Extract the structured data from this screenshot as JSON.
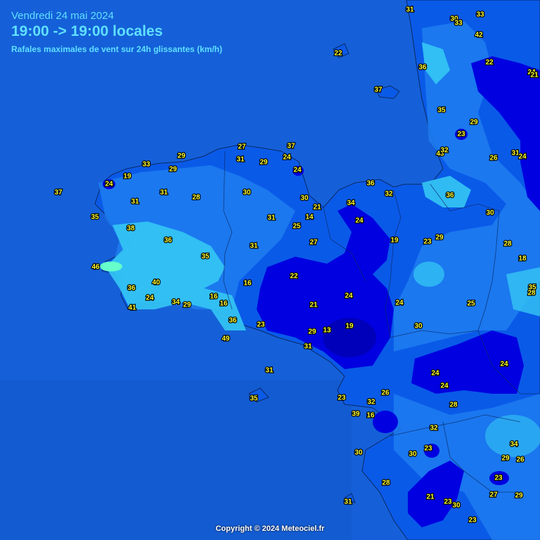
{
  "header": {
    "date": "Vendredi 24 mai 2024",
    "time_range": "19:00 -> 19:00 locales",
    "subtitle": "Rafales maximales de vent sur 24h glissantes (km/h)"
  },
  "copyright": "Copyright © 2024 Meteociel.fr",
  "colors": {
    "sea": "#1560d8",
    "land_mid": "#0a5ae8",
    "band_18_28": "#0000e0",
    "band_30_35": "#1e7ef0",
    "band_36_40": "#34c6f4",
    "band_45_50": "#66ffcc",
    "value_text": "#ffff30"
  },
  "gusts": [
    {
      "v": "31"
    },
    {
      "v": "30"
    },
    {
      "v": "33"
    },
    {
      "v": "33"
    },
    {
      "v": "42"
    },
    {
      "v": "22"
    },
    {
      "v": "22"
    },
    {
      "v": "24"
    },
    {
      "v": "36"
    },
    {
      "v": "37"
    },
    {
      "v": "21"
    },
    {
      "v": "35"
    },
    {
      "v": "29"
    },
    {
      "v": "23"
    },
    {
      "v": "43"
    },
    {
      "v": "32"
    },
    {
      "v": "26"
    },
    {
      "v": "31"
    },
    {
      "v": "24"
    },
    {
      "v": "27"
    },
    {
      "v": "37"
    },
    {
      "v": "29"
    },
    {
      "v": "31"
    },
    {
      "v": "29"
    },
    {
      "v": "24"
    },
    {
      "v": "24"
    },
    {
      "v": "33"
    },
    {
      "v": "29"
    },
    {
      "v": "19"
    },
    {
      "v": "24"
    },
    {
      "v": "37"
    },
    {
      "v": "31"
    },
    {
      "v": "28"
    },
    {
      "v": "30"
    },
    {
      "v": "30"
    },
    {
      "v": "36"
    },
    {
      "v": "32"
    },
    {
      "v": "36"
    },
    {
      "v": "21"
    },
    {
      "v": "34"
    },
    {
      "v": "30"
    },
    {
      "v": "35"
    },
    {
      "v": "31"
    },
    {
      "v": "14"
    },
    {
      "v": "24"
    },
    {
      "v": "25"
    },
    {
      "v": "38"
    },
    {
      "v": "36"
    },
    {
      "v": "31"
    },
    {
      "v": "27"
    },
    {
      "v": "19"
    },
    {
      "v": "23"
    },
    {
      "v": "29"
    },
    {
      "v": "28"
    },
    {
      "v": "35"
    },
    {
      "v": "18"
    },
    {
      "v": "46"
    },
    {
      "v": "22"
    },
    {
      "v": "40"
    },
    {
      "v": "16"
    },
    {
      "v": "36"
    },
    {
      "v": "31"
    },
    {
      "v": "35"
    },
    {
      "v": "24"
    },
    {
      "v": "16"
    },
    {
      "v": "28"
    },
    {
      "v": "34"
    },
    {
      "v": "29"
    },
    {
      "v": "16"
    },
    {
      "v": "21"
    },
    {
      "v": "24"
    },
    {
      "v": "24"
    },
    {
      "v": "41"
    },
    {
      "v": "25"
    },
    {
      "v": "36"
    },
    {
      "v": "23"
    },
    {
      "v": "19"
    },
    {
      "v": "30"
    },
    {
      "v": "29"
    },
    {
      "v": "13"
    },
    {
      "v": "49"
    },
    {
      "v": "31"
    },
    {
      "v": "31"
    },
    {
      "v": "24"
    },
    {
      "v": "24"
    },
    {
      "v": "24"
    },
    {
      "v": "26"
    },
    {
      "v": "23"
    },
    {
      "v": "32"
    },
    {
      "v": "28"
    },
    {
      "v": "39"
    },
    {
      "v": "16"
    },
    {
      "v": "35"
    },
    {
      "v": "32"
    },
    {
      "v": "23"
    },
    {
      "v": "34"
    },
    {
      "v": "30"
    },
    {
      "v": "30"
    },
    {
      "v": "29"
    },
    {
      "v": "26"
    },
    {
      "v": "23"
    },
    {
      "v": "28"
    },
    {
      "v": "27"
    },
    {
      "v": "29"
    },
    {
      "v": "21"
    },
    {
      "v": "23"
    },
    {
      "v": "30"
    },
    {
      "v": "31"
    },
    {
      "v": "23"
    }
  ]
}
